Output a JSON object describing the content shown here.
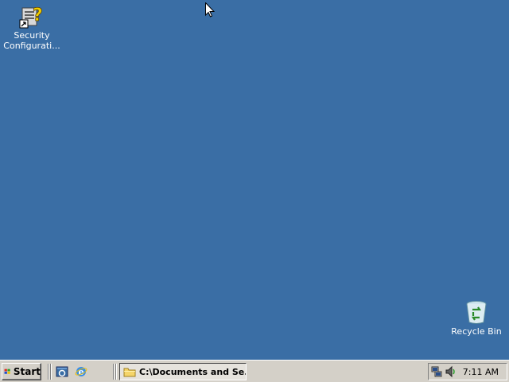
{
  "desktop": {
    "background": "#3a6ea5",
    "icons": [
      {
        "label": "Security Configurati...",
        "icon": "security-config-icon"
      },
      {
        "label": "Recycle Bin",
        "icon": "recycle-bin-icon"
      }
    ]
  },
  "taskbar": {
    "start_label": "Start",
    "quick_launch": [
      "show-desktop-icon",
      "internet-explorer-icon"
    ],
    "tasks": [
      {
        "label": "C:\\Documents and Se...",
        "icon": "folder-icon"
      }
    ],
    "tray": {
      "icons": [
        "network-icon",
        "volume-icon"
      ],
      "time": "7:11 AM"
    }
  }
}
